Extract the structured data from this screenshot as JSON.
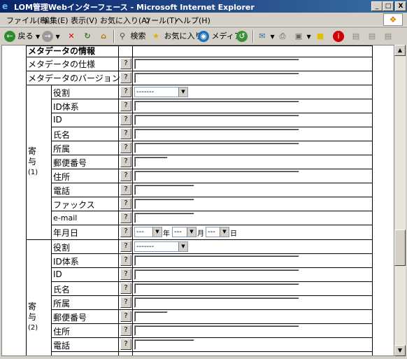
{
  "window": {
    "title": "LOM管理Webインターフェース - Microsoft Internet Explorer",
    "minimize": "_",
    "maximize": "□",
    "close": "X"
  },
  "menu": [
    "ファイル(F)",
    "編集(E)",
    "表示(V)",
    "お気に入り(A)",
    "ツール(T)",
    "ヘルプ(H)"
  ],
  "toolbar": {
    "back": "戻る",
    "search": "検索",
    "favorites": "お気に入り",
    "media": "メディア"
  },
  "form": {
    "section_header": "メタデータの情報",
    "metadata_spec": "メタデータの仕様",
    "metadata_version": "メタデータのバージョン",
    "q": "?",
    "contrib1": {
      "group_label_1": "寄",
      "group_label_2": "与",
      "group_label_3": "(1)",
      "role": "役割",
      "role_select": "-------",
      "id_system": "ID体系",
      "id": "ID",
      "name": "氏名",
      "affiliation": "所属",
      "postal": "郵便番号",
      "address": "住所",
      "phone": "電話",
      "fax": "ファックス",
      "email": "e-mail",
      "date": "年月日",
      "year_select": "---",
      "year_unit": "年",
      "month_select": "---",
      "month_unit": "月",
      "day_select": "---",
      "day_unit": "日"
    },
    "contrib2": {
      "group_label_1": "寄",
      "group_label_2": "与",
      "group_label_3": "(2)",
      "role": "役割",
      "role_select": "-------",
      "id_system": "ID体系",
      "id": "ID",
      "name": "氏名",
      "affiliation": "所属",
      "postal": "郵便番号",
      "address": "住所",
      "phone": "電話"
    }
  }
}
